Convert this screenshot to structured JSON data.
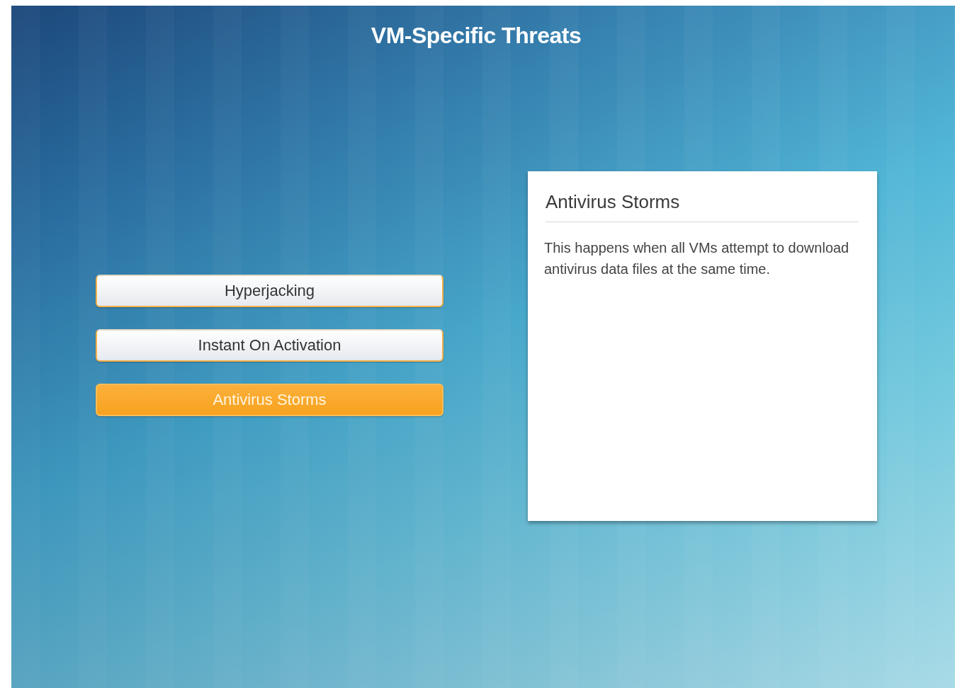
{
  "title": "VM-Specific Threats",
  "options": [
    {
      "label": "Hyperjacking",
      "selected": false
    },
    {
      "label": "Instant On Activation",
      "selected": false
    },
    {
      "label": "Antivirus Storms",
      "selected": true
    }
  ],
  "detail": {
    "heading": "Antivirus Storms",
    "body": "This happens when all VMs attempt to download antivirus data files at the same time."
  }
}
